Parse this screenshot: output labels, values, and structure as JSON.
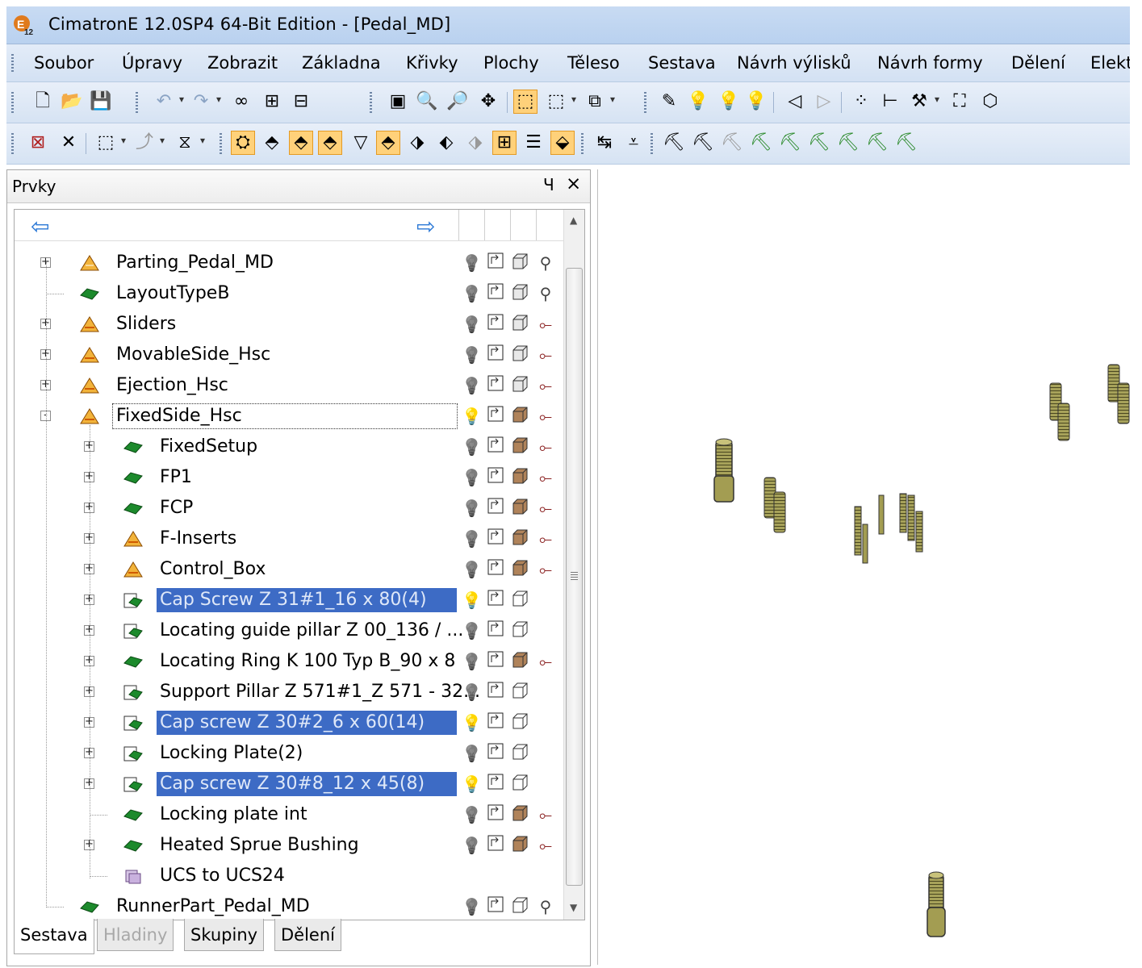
{
  "window": {
    "title": "CimatronE 12.0SP4  64-Bit Edition - [Pedal_MD]",
    "app_icon": "cimatron-e12-icon"
  },
  "menu": [
    "Soubor",
    "Úpravy",
    "Zobrazit",
    "Základna",
    "Křivky",
    "Plochy",
    "Těleso",
    "Sestava",
    "Návrh výlisků",
    "Návrh formy",
    "Dělení",
    "Elekt"
  ],
  "panel": {
    "title": "Prvky",
    "pin_glyph": "Ч",
    "close_glyph": "×",
    "nav_back_icon": "arrow-left-icon",
    "nav_forward_icon": "arrow-right-icon"
  },
  "tree": [
    {
      "label": "Parting_Pedal_MD",
      "depth": 0,
      "expander": "+",
      "icon": "parting-icon",
      "selected": false,
      "focused": false,
      "bulb_on": false,
      "show_box": "grey",
      "extra": "tool"
    },
    {
      "label": "LayoutTypeB",
      "depth": 0,
      "expander": "",
      "icon": "layout-icon",
      "selected": false,
      "focused": false,
      "bulb_on": false,
      "show_box": "grey",
      "extra": "tool"
    },
    {
      "label": "Sliders",
      "depth": 0,
      "expander": "+",
      "icon": "assembly-icon",
      "selected": false,
      "focused": false,
      "bulb_on": false,
      "show_box": "grey",
      "extra": "pin"
    },
    {
      "label": "MovableSide_Hsc",
      "depth": 0,
      "expander": "+",
      "icon": "assembly-icon",
      "selected": false,
      "focused": false,
      "bulb_on": false,
      "show_box": "grey",
      "extra": "pin"
    },
    {
      "label": "Ejection_Hsc",
      "depth": 0,
      "expander": "+",
      "icon": "assembly-icon",
      "selected": false,
      "focused": false,
      "bulb_on": false,
      "show_box": "grey",
      "extra": "pin"
    },
    {
      "label": "FixedSide_Hsc",
      "depth": 0,
      "expander": "-",
      "icon": "assembly-icon",
      "selected": false,
      "focused": true,
      "bulb_on": true,
      "show_box": "brown",
      "extra": "pin"
    },
    {
      "label": "FixedSetup",
      "depth": 1,
      "expander": "+",
      "icon": "part-icon",
      "selected": false,
      "focused": false,
      "bulb_on": false,
      "show_box": "brown",
      "extra": "pin"
    },
    {
      "label": "FP1",
      "depth": 1,
      "expander": "+",
      "icon": "part-icon",
      "selected": false,
      "focused": false,
      "bulb_on": false,
      "show_box": "brown",
      "extra": "pin"
    },
    {
      "label": "FCP",
      "depth": 1,
      "expander": "+",
      "icon": "part-icon",
      "selected": false,
      "focused": false,
      "bulb_on": false,
      "show_box": "brown",
      "extra": "pin"
    },
    {
      "label": "F-Inserts",
      "depth": 1,
      "expander": "+",
      "icon": "assembly-icon",
      "selected": false,
      "focused": false,
      "bulb_on": false,
      "show_box": "brown",
      "extra": "pin"
    },
    {
      "label": "Control_Box",
      "depth": 1,
      "expander": "+",
      "icon": "assembly-icon",
      "selected": false,
      "focused": false,
      "bulb_on": false,
      "show_box": "brown",
      "extra": "pin"
    },
    {
      "label": "Cap Screw Z 31#1_16 x 80(4)",
      "depth": 1,
      "expander": "+",
      "icon": "catalog-part-icon",
      "selected": true,
      "focused": false,
      "bulb_on": true,
      "show_box": "outline",
      "extra": ""
    },
    {
      "label": "Locating guide pillar Z 00_136 / ...",
      "depth": 1,
      "expander": "+",
      "icon": "catalog-part-icon",
      "selected": false,
      "focused": false,
      "bulb_on": false,
      "show_box": "outline",
      "extra": ""
    },
    {
      "label": "Locating Ring K 100 Typ B_90 x 8",
      "depth": 1,
      "expander": "+",
      "icon": "part-icon",
      "selected": false,
      "focused": false,
      "bulb_on": false,
      "show_box": "brown",
      "extra": "pin"
    },
    {
      "label": "Support Pillar Z 571#1_Z 571 - 32...",
      "depth": 1,
      "expander": "+",
      "icon": "catalog-part-icon",
      "selected": false,
      "focused": false,
      "bulb_on": false,
      "show_box": "outline",
      "extra": ""
    },
    {
      "label": "Cap screw Z 30#2_6 x 60(14)",
      "depth": 1,
      "expander": "+",
      "icon": "catalog-part-icon",
      "selected": true,
      "focused": false,
      "bulb_on": true,
      "show_box": "outline",
      "extra": ""
    },
    {
      "label": "Locking Plate(2)",
      "depth": 1,
      "expander": "+",
      "icon": "catalog-part-icon",
      "selected": false,
      "focused": false,
      "bulb_on": false,
      "show_box": "outline",
      "extra": ""
    },
    {
      "label": "Cap screw Z 30#8_12 x 45(8)",
      "depth": 1,
      "expander": "+",
      "icon": "catalog-part-icon",
      "selected": true,
      "focused": false,
      "bulb_on": true,
      "show_box": "outline",
      "extra": ""
    },
    {
      "label": "Locking plate int",
      "depth": 1,
      "expander": "",
      "icon": "part-icon",
      "selected": false,
      "focused": false,
      "bulb_on": false,
      "show_box": "brown",
      "extra": "pin"
    },
    {
      "label": "Heated Sprue Bushing",
      "depth": 1,
      "expander": "+",
      "icon": "part-icon",
      "selected": false,
      "focused": false,
      "bulb_on": false,
      "show_box": "brown",
      "extra": "pin"
    },
    {
      "label": "UCS to UCS24",
      "depth": 1,
      "expander": "",
      "icon": "ucs-icon",
      "selected": false,
      "focused": false,
      "bulb_on": null,
      "show_box": null,
      "extra": ""
    },
    {
      "label": "RunnerPart_Pedal_MD",
      "depth": 0,
      "expander": "",
      "icon": "part-icon",
      "selected": false,
      "focused": false,
      "bulb_on": false,
      "show_box": "outline",
      "extra": "tool"
    }
  ],
  "tabs": [
    {
      "label": "Sestava",
      "active": true,
      "enabled": true
    },
    {
      "label": "Hladiny",
      "active": false,
      "enabled": false
    },
    {
      "label": "Skupiny",
      "active": false,
      "enabled": true
    },
    {
      "label": "Dělení",
      "active": false,
      "enabled": true
    }
  ],
  "colors": {
    "selection": "#3d6bc5",
    "titlebar": "#c8dbf3",
    "bolt_body": "#8e8a45",
    "bulb_on": "#f6e000"
  }
}
